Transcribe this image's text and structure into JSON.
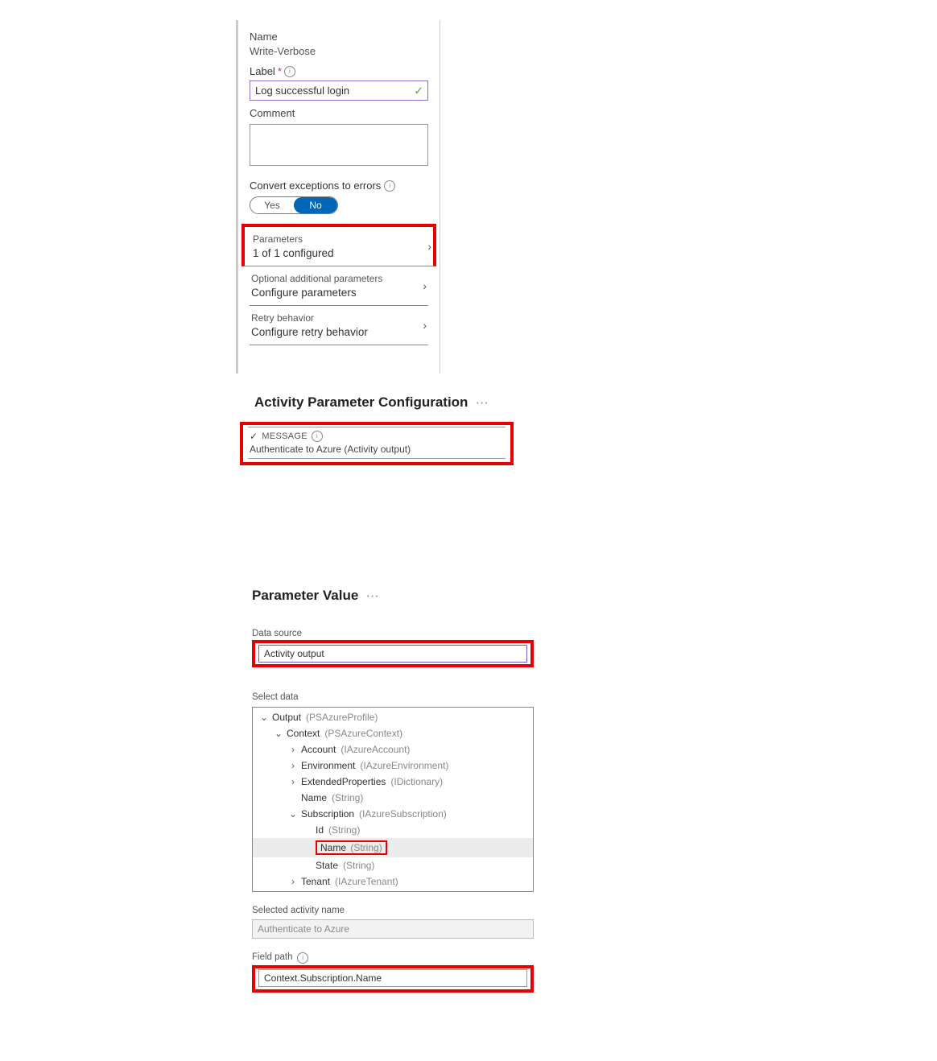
{
  "activity": {
    "name_label": "Name",
    "name_value": "Write-Verbose",
    "label_label": "Label",
    "label_value": "Log successful login",
    "comment_label": "Comment",
    "comment_value": "",
    "convert_label": "Convert exceptions to errors",
    "toggle_yes": "Yes",
    "toggle_no": "No",
    "sections": [
      {
        "title": "Parameters",
        "sub": "1 of 1 configured",
        "highlight": true
      },
      {
        "title": "Optional additional parameters",
        "sub": "Configure parameters",
        "highlight": false
      },
      {
        "title": "Retry behavior",
        "sub": "Configure retry behavior",
        "highlight": false
      }
    ]
  },
  "paramcfg": {
    "heading": "Activity Parameter Configuration",
    "msg_label": "MESSAGE",
    "msg_value": "Authenticate to Azure (Activity output)"
  },
  "paramval": {
    "heading": "Parameter Value",
    "data_source_label": "Data source",
    "data_source_value": "Activity output",
    "select_data_label": "Select data",
    "tree": [
      {
        "indent": 0,
        "expand": "open",
        "name": "Output",
        "type": "(PSAzureProfile)",
        "selected": false
      },
      {
        "indent": 1,
        "expand": "open",
        "name": "Context",
        "type": "(PSAzureContext)",
        "selected": false
      },
      {
        "indent": 2,
        "expand": "closed",
        "name": "Account",
        "type": "(IAzureAccount)",
        "selected": false
      },
      {
        "indent": 2,
        "expand": "closed",
        "name": "Environment",
        "type": "(IAzureEnvironment)",
        "selected": false
      },
      {
        "indent": 2,
        "expand": "closed",
        "name": "ExtendedProperties",
        "type": "(IDictionary)",
        "selected": false
      },
      {
        "indent": 2,
        "expand": "leaf",
        "name": "Name",
        "type": "(String)",
        "selected": false
      },
      {
        "indent": 2,
        "expand": "open",
        "name": "Subscription",
        "type": "(IAzureSubscription)",
        "selected": false
      },
      {
        "indent": 3,
        "expand": "leaf",
        "name": "Id",
        "type": "(String)",
        "selected": false
      },
      {
        "indent": 3,
        "expand": "leaf",
        "name": "Name",
        "type": "(String)",
        "selected": true,
        "redbox": true
      },
      {
        "indent": 3,
        "expand": "leaf",
        "name": "State",
        "type": "(String)",
        "selected": false
      },
      {
        "indent": 2,
        "expand": "closed",
        "name": "Tenant",
        "type": "(IAzureTenant)",
        "selected": false
      }
    ],
    "selected_activity_label": "Selected activity name",
    "selected_activity_value": "Authenticate to Azure",
    "field_path_label": "Field path",
    "field_path_value": "Context.Subscription.Name"
  }
}
